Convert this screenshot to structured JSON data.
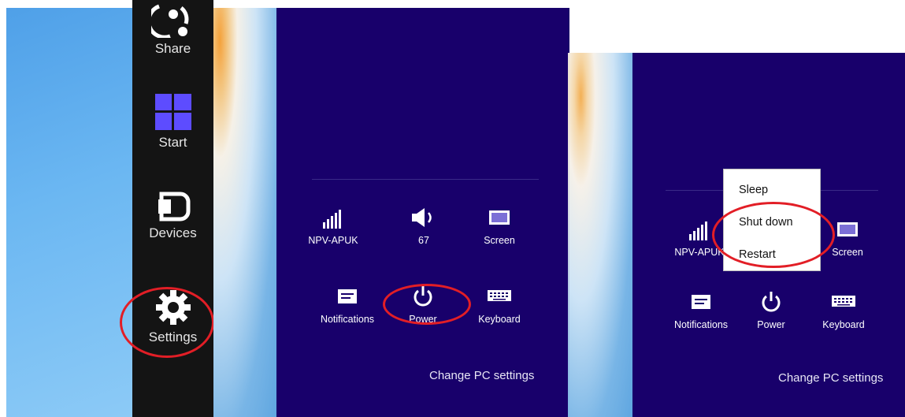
{
  "charms": {
    "share_label": "Share",
    "start_label": "Start",
    "devices_label": "Devices",
    "settings_label": "Settings"
  },
  "settings_panel": {
    "network_label": "NPV-APUK",
    "volume_label": "67",
    "screen_label": "Screen",
    "notifications_label": "Notifications",
    "power_label": "Power",
    "keyboard_label": "Keyboard",
    "change_pc_settings": "Change PC settings"
  },
  "settings_panel_2": {
    "network_label": "NPV-APUK",
    "screen_label": "Screen",
    "notifications_label": "Notifications",
    "power_label": "Power",
    "keyboard_label": "Keyboard",
    "change_pc_settings": "Change PC settings"
  },
  "power_menu": {
    "sleep": "Sleep",
    "shut_down": "Shut down",
    "restart": "Restart"
  },
  "colors": {
    "panel_bg": "#18006b",
    "charm_bar": "#141414",
    "highlight_ring": "#e21e26",
    "start_tile": "#5d4cff"
  }
}
